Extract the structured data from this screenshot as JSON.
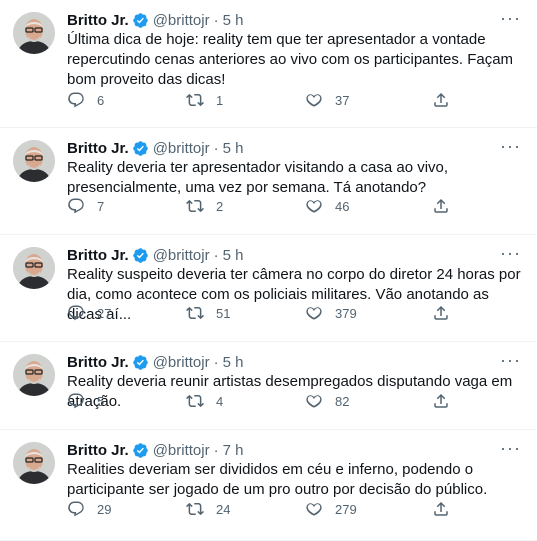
{
  "tweets": [
    {
      "name": "Britto Jr.",
      "handle": "@brittojr",
      "dot": "·",
      "time": "5 h",
      "text": "Última dica de hoje: reality tem que ter apresentador a vontade repercutindo cenas anteriores ao vivo com os participantes. Façam bom proveito das dicas!",
      "replies": "6",
      "retweets": "1",
      "likes": "37"
    },
    {
      "name": "Britto Jr.",
      "handle": "@brittojr",
      "dot": "·",
      "time": "5 h",
      "text": "Reality deveria ter apresentador visitando a casa ao vivo, presencialmente, uma vez por semana. Tá anotando?",
      "replies": "7",
      "retweets": "2",
      "likes": "46"
    },
    {
      "name": "Britto Jr.",
      "handle": "@brittojr",
      "dot": "·",
      "time": "5 h",
      "text": "Reality suspeito deveria ter câmera no corpo do diretor 24 horas por dia, como acontece com os policiais militares. Vão anotando as dicas aí...",
      "replies": "27",
      "retweets": "51",
      "likes": "379"
    },
    {
      "name": "Britto Jr.",
      "handle": "@brittojr",
      "dot": "·",
      "time": "5 h",
      "text": "Reality deveria reunir artistas desempregados disputando vaga em atração.",
      "replies": "5",
      "retweets": "4",
      "likes": "82"
    },
    {
      "name": "Britto Jr.",
      "handle": "@brittojr",
      "dot": "·",
      "time": "7 h",
      "text": "Realities deveriam ser divididos em céu e inferno, podendo o participante ser jogado de um pro outro por decisão do público.",
      "replies": "29",
      "retweets": "24",
      "likes": "279"
    }
  ],
  "colors": {
    "verified": "#1d9bf0",
    "muted": "#536471",
    "text": "#0f1419",
    "divider": "#eff3f4"
  },
  "icons": {
    "reply": "reply-icon",
    "retweet": "retweet-icon",
    "like": "heart-icon",
    "share": "share-icon",
    "more": "more-icon",
    "verified": "verified-badge-icon"
  }
}
